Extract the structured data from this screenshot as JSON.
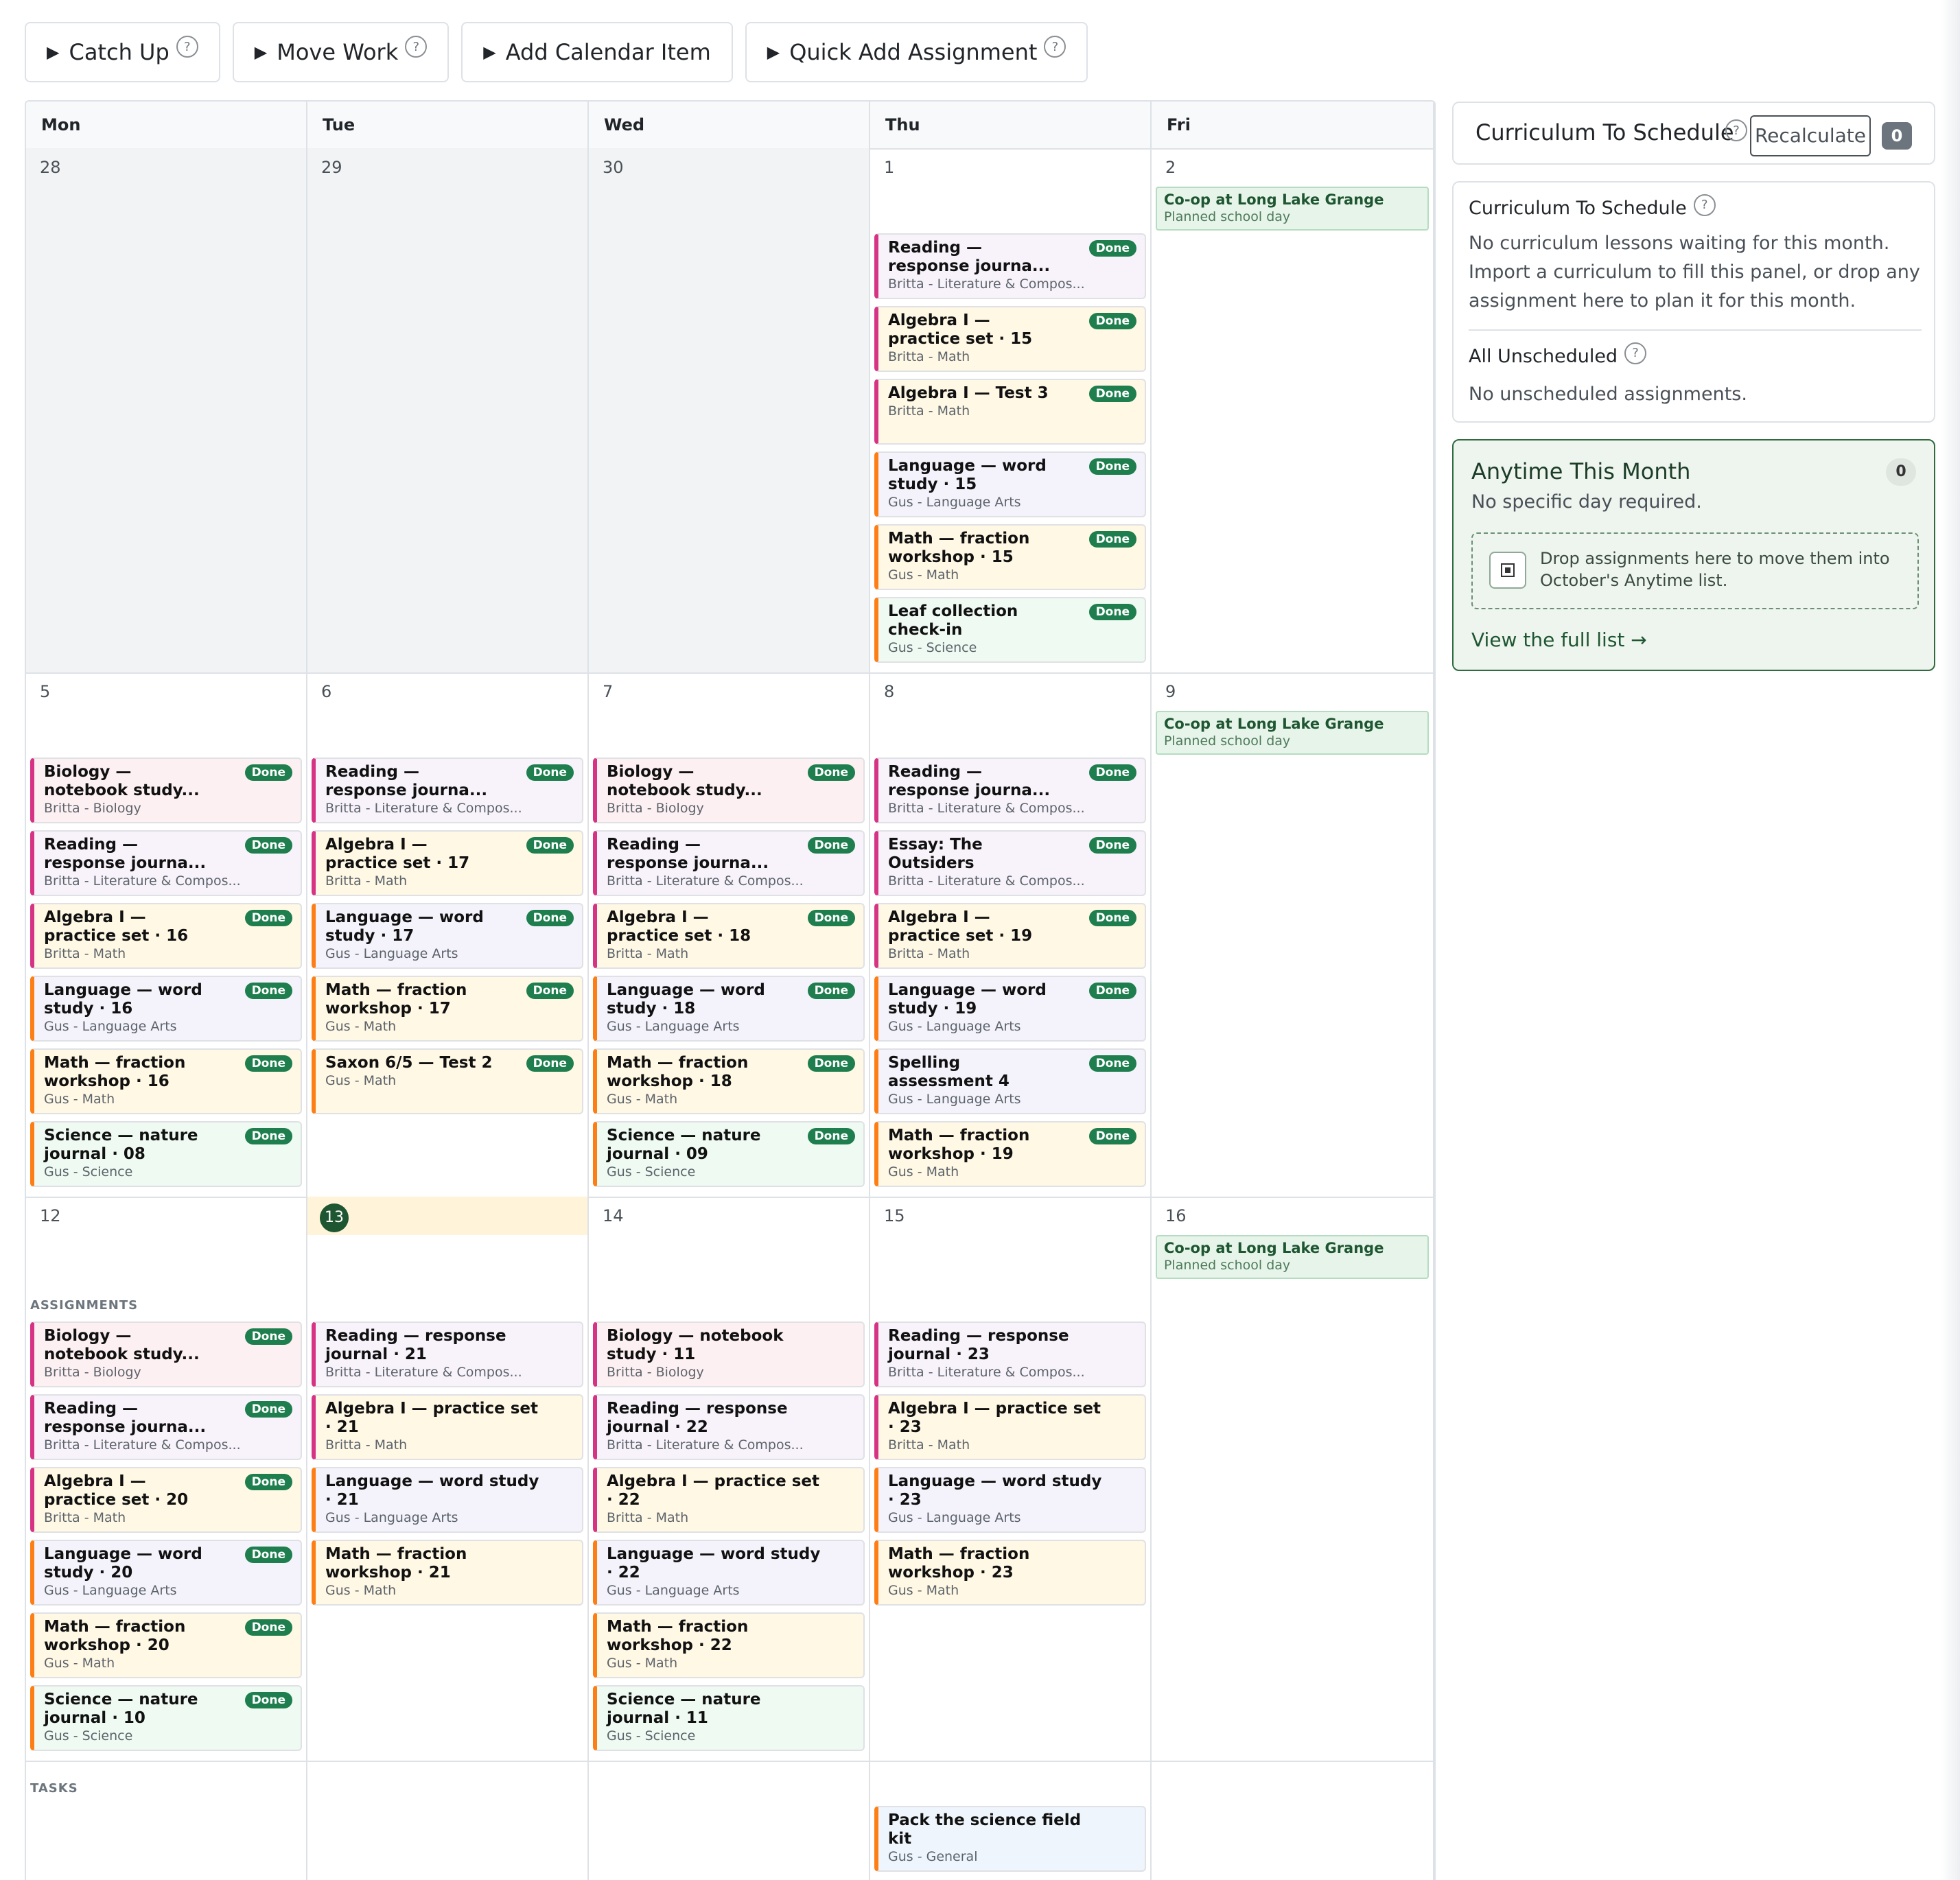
{
  "toolbar": {
    "catch_up": "Catch Up",
    "move_work": "Move Work",
    "add_calendar_item": "Add Calendar Item",
    "quick_add_assignment": "Quick Add Assignment",
    "help_glyph": "?"
  },
  "calendar": {
    "day_names": [
      "Mon",
      "Tue",
      "Wed",
      "Thu",
      "Fri"
    ],
    "done_label": "Done",
    "section_assignments": "ASSIGNMENTS",
    "section_tasks": "TASKS",
    "weeks": [
      {
        "days": [
          {
            "num": "28",
            "other": true,
            "event": null,
            "cards": []
          },
          {
            "num": "29",
            "other": true,
            "event": null,
            "cards": []
          },
          {
            "num": "30",
            "other": true,
            "event": null,
            "cards": []
          },
          {
            "num": "1",
            "event": null,
            "cards": [
              {
                "title": "Reading — response journa...",
                "sub": "Britta - Literature & Compos...",
                "done": true,
                "style": "b-read"
              },
              {
                "title": "Algebra I — practice set · 15",
                "sub": "Britta - Math",
                "done": true,
                "style": "b-alg"
              },
              {
                "title": "Algebra I — Test 3",
                "sub": "Britta - Math",
                "done": true,
                "style": "b-alg"
              },
              {
                "title": "Language — word study · 15",
                "sub": "Gus - Language Arts",
                "done": true,
                "style": "g-lang"
              },
              {
                "title": "Math — fraction workshop · 15",
                "sub": "Gus - Math",
                "done": true,
                "style": "g-math"
              },
              {
                "title": "Leaf collection check-in",
                "sub": "Gus - Science",
                "done": true,
                "style": "g-sci"
              }
            ]
          },
          {
            "num": "2",
            "event": {
              "title": "Co-op at Long Lake Grange",
              "sub": "Planned school day"
            },
            "cards": []
          }
        ]
      },
      {
        "days": [
          {
            "num": "5",
            "event": null,
            "cards": [
              {
                "title": "Biology — notebook study...",
                "sub": "Britta - Biology",
                "done": true,
                "style": "b-bio"
              },
              {
                "title": "Reading — response journa...",
                "sub": "Britta - Literature & Compos...",
                "done": true,
                "style": "b-read"
              },
              {
                "title": "Algebra I — practice set · 16",
                "sub": "Britta - Math",
                "done": true,
                "style": "b-alg"
              },
              {
                "title": "Language — word study · 16",
                "sub": "Gus - Language Arts",
                "done": true,
                "style": "g-lang"
              },
              {
                "title": "Math — fraction workshop · 16",
                "sub": "Gus - Math",
                "done": true,
                "style": "g-math"
              },
              {
                "title": "Science — nature journal · 08",
                "sub": "Gus - Science",
                "done": true,
                "style": "g-sci"
              }
            ]
          },
          {
            "num": "6",
            "event": null,
            "cards": [
              {
                "title": "Reading — response journa...",
                "sub": "Britta - Literature & Compos...",
                "done": true,
                "style": "b-read"
              },
              {
                "title": "Algebra I — practice set · 17",
                "sub": "Britta - Math",
                "done": true,
                "style": "b-alg"
              },
              {
                "title": "Language — word study · 17",
                "sub": "Gus - Language Arts",
                "done": true,
                "style": "g-lang"
              },
              {
                "title": "Math — fraction workshop · 17",
                "sub": "Gus - Math",
                "done": true,
                "style": "g-math"
              },
              {
                "title": "Saxon 6/5 — Test 2",
                "sub": "Gus - Math",
                "done": true,
                "style": "g-math"
              }
            ]
          },
          {
            "num": "7",
            "event": null,
            "cards": [
              {
                "title": "Biology — notebook study...",
                "sub": "Britta - Biology",
                "done": true,
                "style": "b-bio"
              },
              {
                "title": "Reading — response journa...",
                "sub": "Britta - Literature & Compos...",
                "done": true,
                "style": "b-read"
              },
              {
                "title": "Algebra I — practice set · 18",
                "sub": "Britta - Math",
                "done": true,
                "style": "b-alg"
              },
              {
                "title": "Language — word study · 18",
                "sub": "Gus - Language Arts",
                "done": true,
                "style": "g-lang"
              },
              {
                "title": "Math — fraction workshop · 18",
                "sub": "Gus - Math",
                "done": true,
                "style": "g-math"
              },
              {
                "title": "Science — nature journal · 09",
                "sub": "Gus - Science",
                "done": true,
                "style": "g-sci"
              }
            ]
          },
          {
            "num": "8",
            "event": null,
            "cards": [
              {
                "title": "Reading — response journa...",
                "sub": "Britta - Literature & Compos...",
                "done": true,
                "style": "b-read"
              },
              {
                "title": "Essay: The Outsiders",
                "sub": "Britta - Literature & Compos...",
                "done": true,
                "style": "b-read"
              },
              {
                "title": "Algebra I — practice set · 19",
                "sub": "Britta - Math",
                "done": true,
                "style": "b-alg"
              },
              {
                "title": "Language — word study · 19",
                "sub": "Gus - Language Arts",
                "done": true,
                "style": "g-lang"
              },
              {
                "title": "Spelling assessment 4",
                "sub": "Gus - Language Arts",
                "done": true,
                "style": "g-lang"
              },
              {
                "title": "Math — fraction workshop · 19",
                "sub": "Gus - Math",
                "done": true,
                "style": "g-math"
              }
            ]
          },
          {
            "num": "9",
            "event": {
              "title": "Co-op at Long Lake Grange",
              "sub": "Planned school day"
            },
            "cards": []
          }
        ]
      },
      {
        "days": [
          {
            "num": "12",
            "event": null,
            "cards": [
              {
                "title": "Biology — notebook study...",
                "sub": "Britta - Biology",
                "done": true,
                "style": "b-bio"
              },
              {
                "title": "Reading — response journa...",
                "sub": "Britta - Literature & Compos...",
                "done": true,
                "style": "b-read"
              },
              {
                "title": "Algebra I — practice set · 20",
                "sub": "Britta - Math",
                "done": true,
                "style": "b-alg"
              },
              {
                "title": "Language — word study · 20",
                "sub": "Gus - Language Arts",
                "done": true,
                "style": "g-lang"
              },
              {
                "title": "Math — fraction workshop · 20",
                "sub": "Gus - Math",
                "done": true,
                "style": "g-math"
              },
              {
                "title": "Science — nature journal · 10",
                "sub": "Gus - Science",
                "done": true,
                "style": "g-sci"
              }
            ],
            "tasks": []
          },
          {
            "num": "13",
            "today": true,
            "event": null,
            "cards": [
              {
                "title": "Reading — response journal · 21",
                "sub": "Britta - Literature & Compos...",
                "done": false,
                "style": "b-read"
              },
              {
                "title": "Algebra I — practice set · 21",
                "sub": "Britta - Math",
                "done": false,
                "style": "b-alg"
              },
              {
                "title": "Language — word study · 21",
                "sub": "Gus - Language Arts",
                "done": false,
                "style": "g-lang"
              },
              {
                "title": "Math — fraction workshop · 21",
                "sub": "Gus - Math",
                "done": false,
                "style": "g-math"
              }
            ],
            "tasks": []
          },
          {
            "num": "14",
            "event": null,
            "cards": [
              {
                "title": "Biology — notebook study · 11",
                "sub": "Britta - Biology",
                "done": false,
                "style": "b-bio"
              },
              {
                "title": "Reading — response journal · 22",
                "sub": "Britta - Literature & Compos...",
                "done": false,
                "style": "b-read"
              },
              {
                "title": "Algebra I — practice set · 22",
                "sub": "Britta - Math",
                "done": false,
                "style": "b-alg"
              },
              {
                "title": "Language — word study · 22",
                "sub": "Gus - Language Arts",
                "done": false,
                "style": "g-lang"
              },
              {
                "title": "Math — fraction workshop · 22",
                "sub": "Gus - Math",
                "done": false,
                "style": "g-math"
              },
              {
                "title": "Science — nature journal · 11",
                "sub": "Gus - Science",
                "done": false,
                "style": "g-sci"
              }
            ],
            "tasks": []
          },
          {
            "num": "15",
            "event": null,
            "cards": [
              {
                "title": "Reading — response journal · 23",
                "sub": "Britta - Literature & Compos...",
                "done": false,
                "style": "b-read"
              },
              {
                "title": "Algebra I — practice set · 23",
                "sub": "Britta - Math",
                "done": false,
                "style": "b-alg"
              },
              {
                "title": "Language — word study · 23",
                "sub": "Gus - Language Arts",
                "done": false,
                "style": "g-lang"
              },
              {
                "title": "Math — fraction workshop · 23",
                "sub": "Gus - Math",
                "done": false,
                "style": "g-math"
              }
            ],
            "tasks": [
              {
                "title": "Pack the science field kit",
                "sub": "Gus - General",
                "done": false,
                "style": "g-gen"
              }
            ]
          },
          {
            "num": "16",
            "event": {
              "title": "Co-op at Long Lake Grange",
              "sub": "Planned school day"
            },
            "cards": [],
            "tasks": []
          }
        ]
      }
    ]
  },
  "sidebar": {
    "header_title": "Curriculum To Schedule",
    "recalculate": "Recalculate",
    "header_count": "0",
    "curriculum_title": "Curriculum To Schedule",
    "curriculum_text": "No curriculum lessons waiting for this month. Import a curriculum to fill this panel, or drop any assignment here to plan it for this month.",
    "unscheduled_title": "All Unscheduled",
    "unscheduled_text": "No unscheduled assignments.",
    "anytime_title": "Anytime This Month",
    "anytime_count": "0",
    "anytime_sub": "No specific day required.",
    "drop_text": "Drop assignments here to move them into October's Anytime list.",
    "view_all": "View the full list →"
  }
}
